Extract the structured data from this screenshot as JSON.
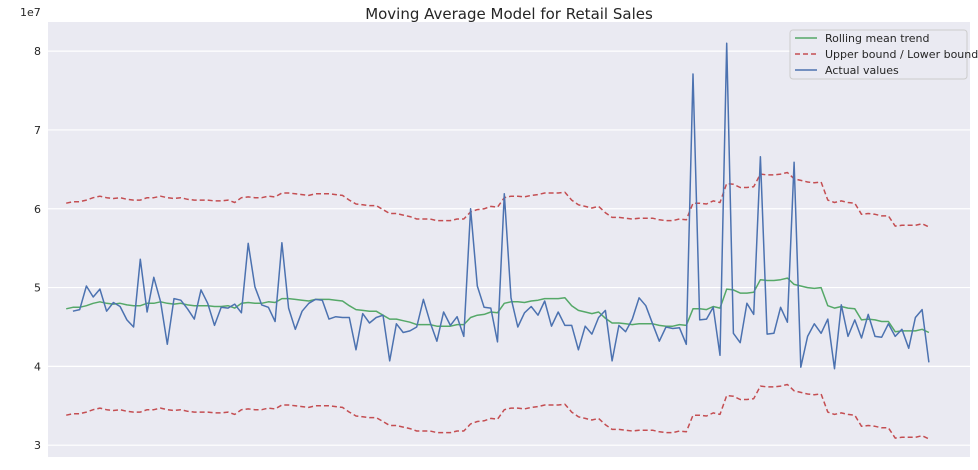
{
  "chart_data": {
    "type": "line",
    "title": "Moving Average Model for Retail Sales",
    "xlabel": "",
    "ylabel": "",
    "y_offset_label": "1e7",
    "y_scale_multiplier": 10000000,
    "ylim": [
      2.85,
      8.37
    ],
    "xlim": [
      -2.7,
      134.1
    ],
    "y_ticks": [
      3,
      4,
      5,
      6,
      7,
      8
    ],
    "x_tick_labels_shown": false,
    "grid": true,
    "background": "#eaeaf2",
    "legend_position": "top-right",
    "series": [
      {
        "name": "Rolling mean trend",
        "color": "#55a868",
        "style": "solid",
        "values": [
          4.73,
          4.75,
          4.75,
          4.77,
          4.8,
          4.82,
          4.8,
          4.79,
          4.8,
          4.78,
          4.77,
          4.77,
          4.8,
          4.8,
          4.82,
          4.8,
          4.79,
          4.8,
          4.78,
          4.77,
          4.77,
          4.77,
          4.76,
          4.76,
          4.77,
          4.74,
          4.8,
          4.81,
          4.8,
          4.8,
          4.82,
          4.81,
          4.86,
          4.86,
          4.85,
          4.84,
          4.83,
          4.85,
          4.85,
          4.85,
          4.84,
          4.83,
          4.77,
          4.72,
          4.71,
          4.7,
          4.7,
          4.65,
          4.6,
          4.6,
          4.58,
          4.56,
          4.53,
          4.53,
          4.53,
          4.51,
          4.51,
          4.51,
          4.53,
          4.53,
          4.62,
          4.65,
          4.66,
          4.69,
          4.68,
          4.8,
          4.82,
          4.82,
          4.81,
          4.83,
          4.84,
          4.86,
          4.86,
          4.86,
          4.87,
          4.77,
          4.71,
          4.69,
          4.67,
          4.69,
          4.61,
          4.55,
          4.55,
          4.54,
          4.53,
          4.54,
          4.54,
          4.54,
          4.52,
          4.51,
          4.51,
          4.53,
          4.52,
          4.73,
          4.73,
          4.72,
          4.76,
          4.74,
          4.98,
          4.97,
          4.93,
          4.93,
          4.94,
          5.1,
          5.09,
          5.09,
          5.1,
          5.12,
          5.04,
          5.02,
          5.0,
          4.99,
          5.0,
          4.77,
          4.74,
          4.76,
          4.74,
          4.73,
          4.59,
          4.6,
          4.59,
          4.57,
          4.57,
          4.44,
          4.45,
          4.45,
          4.45,
          4.47,
          4.43
        ]
      },
      {
        "name": "Upper bound / Lower bound",
        "color": "#c44e52",
        "style": "dashed",
        "upper": [
          6.07,
          6.09,
          6.09,
          6.11,
          6.14,
          6.16,
          6.14,
          6.13,
          6.14,
          6.12,
          6.11,
          6.11,
          6.14,
          6.14,
          6.16,
          6.14,
          6.13,
          6.14,
          6.12,
          6.11,
          6.11,
          6.11,
          6.1,
          6.1,
          6.11,
          6.08,
          6.14,
          6.15,
          6.14,
          6.14,
          6.16,
          6.15,
          6.2,
          6.2,
          6.19,
          6.18,
          6.17,
          6.19,
          6.19,
          6.19,
          6.18,
          6.17,
          6.11,
          6.06,
          6.05,
          6.04,
          6.04,
          5.99,
          5.94,
          5.94,
          5.92,
          5.9,
          5.87,
          5.87,
          5.87,
          5.85,
          5.85,
          5.85,
          5.87,
          5.87,
          5.96,
          5.99,
          6.0,
          6.03,
          6.02,
          6.14,
          6.16,
          6.16,
          6.15,
          6.17,
          6.18,
          6.2,
          6.2,
          6.2,
          6.21,
          6.11,
          6.05,
          6.03,
          6.01,
          6.03,
          5.95,
          5.89,
          5.89,
          5.88,
          5.87,
          5.88,
          5.88,
          5.88,
          5.86,
          5.85,
          5.85,
          5.87,
          5.86,
          6.07,
          6.07,
          6.06,
          6.1,
          6.08,
          6.32,
          6.31,
          6.27,
          6.27,
          6.28,
          6.44,
          6.43,
          6.43,
          6.44,
          6.46,
          6.38,
          6.36,
          6.34,
          6.33,
          6.34,
          6.11,
          6.08,
          6.1,
          6.08,
          6.07,
          5.93,
          5.94,
          5.93,
          5.91,
          5.91,
          5.78,
          5.79,
          5.79,
          5.79,
          5.81,
          5.77
        ],
        "lower": [
          3.38,
          3.4,
          3.4,
          3.42,
          3.45,
          3.47,
          3.45,
          3.44,
          3.45,
          3.43,
          3.42,
          3.42,
          3.45,
          3.45,
          3.47,
          3.45,
          3.44,
          3.45,
          3.43,
          3.42,
          3.42,
          3.42,
          3.41,
          3.41,
          3.42,
          3.39,
          3.45,
          3.46,
          3.45,
          3.45,
          3.47,
          3.46,
          3.51,
          3.51,
          3.5,
          3.49,
          3.48,
          3.5,
          3.5,
          3.5,
          3.49,
          3.48,
          3.42,
          3.37,
          3.36,
          3.35,
          3.35,
          3.3,
          3.25,
          3.25,
          3.23,
          3.21,
          3.18,
          3.18,
          3.18,
          3.16,
          3.16,
          3.16,
          3.18,
          3.18,
          3.27,
          3.3,
          3.31,
          3.34,
          3.33,
          3.45,
          3.47,
          3.47,
          3.46,
          3.48,
          3.49,
          3.51,
          3.51,
          3.51,
          3.52,
          3.42,
          3.36,
          3.34,
          3.32,
          3.34,
          3.26,
          3.2,
          3.2,
          3.19,
          3.18,
          3.19,
          3.19,
          3.19,
          3.17,
          3.16,
          3.16,
          3.18,
          3.17,
          3.38,
          3.38,
          3.37,
          3.41,
          3.39,
          3.63,
          3.62,
          3.58,
          3.58,
          3.59,
          3.75,
          3.74,
          3.74,
          3.75,
          3.77,
          3.69,
          3.67,
          3.65,
          3.64,
          3.65,
          3.42,
          3.39,
          3.41,
          3.39,
          3.38,
          3.24,
          3.25,
          3.24,
          3.22,
          3.22,
          3.09,
          3.1,
          3.1,
          3.1,
          3.12,
          3.08
        ]
      },
      {
        "name": "Actual values",
        "color": "#4c72b0",
        "style": "solid",
        "values": [
          null,
          4.7,
          4.72,
          5.02,
          4.88,
          4.98,
          4.7,
          4.81,
          4.76,
          4.59,
          4.5,
          5.36,
          4.69,
          5.13,
          4.82,
          4.28,
          4.86,
          4.84,
          4.73,
          4.6,
          4.97,
          4.8,
          4.52,
          4.75,
          4.74,
          4.79,
          4.68,
          5.56,
          5.01,
          4.78,
          4.75,
          4.57,
          5.57,
          4.74,
          4.47,
          4.7,
          4.8,
          4.85,
          4.84,
          4.6,
          4.63,
          4.62,
          4.62,
          4.21,
          4.67,
          4.55,
          4.62,
          4.65,
          4.07,
          4.54,
          4.43,
          4.45,
          4.5,
          4.85,
          4.56,
          4.32,
          4.69,
          4.52,
          4.63,
          4.38,
          6.0,
          5.02,
          4.75,
          4.74,
          4.31,
          6.19,
          4.87,
          4.5,
          4.68,
          4.76,
          4.65,
          4.83,
          4.51,
          4.69,
          4.52,
          4.52,
          4.21,
          4.51,
          4.41,
          4.62,
          4.71,
          4.07,
          4.52,
          4.44,
          4.6,
          4.87,
          4.77,
          4.54,
          4.32,
          4.5,
          4.48,
          4.49,
          4.28,
          7.71,
          4.59,
          4.6,
          4.75,
          4.14,
          8.1,
          4.42,
          4.3,
          4.8,
          4.66,
          6.66,
          4.41,
          4.42,
          4.75,
          4.56,
          6.59,
          3.99,
          4.38,
          4.54,
          4.42,
          4.6,
          3.97,
          4.78,
          4.38,
          4.59,
          4.36,
          4.66,
          4.38,
          4.37,
          4.54,
          4.38,
          4.47,
          4.23,
          4.62,
          4.72,
          4.05
        ]
      }
    ]
  }
}
